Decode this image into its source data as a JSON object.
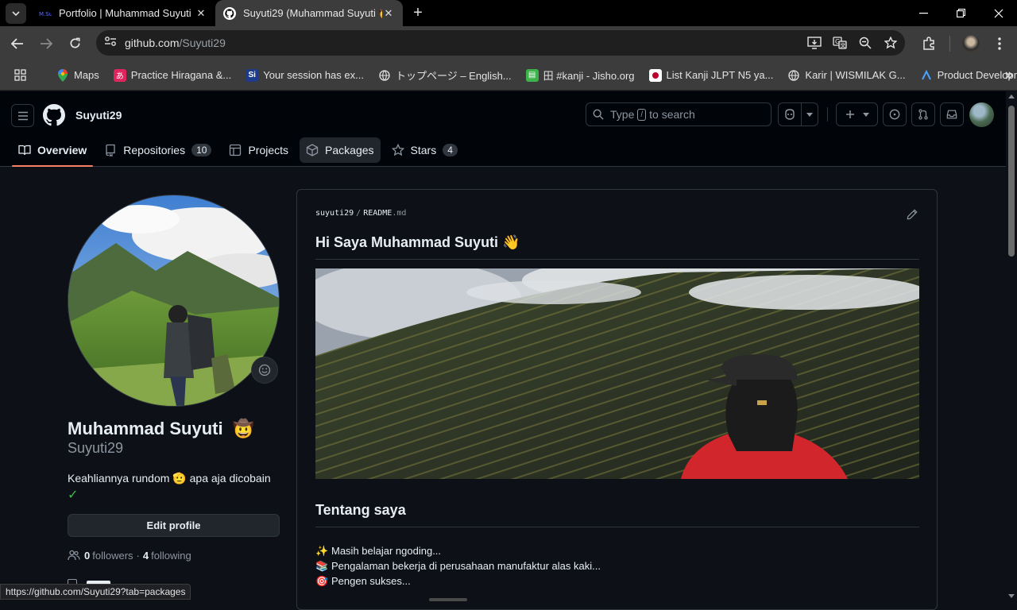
{
  "browser": {
    "tabs": [
      {
        "title": "Portfolio | Muhammad Suyuti",
        "favicon": "portfolio-favicon",
        "active": false
      },
      {
        "title": "Suyuti29 (Muhammad Suyuti 🤠",
        "favicon": "github-favicon",
        "active": true
      }
    ],
    "url_host": "github.com",
    "url_path": "/Suyuti29",
    "bookmarks": [
      {
        "label": "Maps",
        "icon": "maps-icon"
      },
      {
        "label": "Practice Hiragana &...",
        "icon": "hiragana-icon"
      },
      {
        "label": "Your session has ex...",
        "icon": "session-icon"
      },
      {
        "label": "トップページ – English...",
        "icon": "globe-icon"
      },
      {
        "label": "田 #kanji - Jisho.org",
        "icon": "jisho-icon"
      },
      {
        "label": "List Kanji JLPT N5 ya...",
        "icon": "japan-flag-icon"
      },
      {
        "label": "Karir | WISMILAK G...",
        "icon": "globe-icon"
      },
      {
        "label": "Product Developme...",
        "icon": "product-icon"
      }
    ],
    "status_url": "https://github.com/Suyuti29?tab=packages"
  },
  "header": {
    "username": "Suyuti29",
    "search_prefix": "Type",
    "search_key": "/",
    "search_suffix": "to search"
  },
  "nav": {
    "tabs": [
      {
        "label": "Overview",
        "icon": "book-icon",
        "count": null
      },
      {
        "label": "Repositories",
        "icon": "repo-icon",
        "count": "10"
      },
      {
        "label": "Projects",
        "icon": "table-icon",
        "count": null
      },
      {
        "label": "Packages",
        "icon": "package-icon",
        "count": null
      },
      {
        "label": "Stars",
        "icon": "star-icon",
        "count": "4"
      }
    ]
  },
  "profile": {
    "name": "Muhammad Suyuti",
    "name_emoji": "🤠",
    "login": "Suyuti29",
    "bio": "Keahliannya rundom 🫡 apa aja dicobain",
    "bio_check": "✓",
    "edit_label": "Edit profile",
    "followers": "0",
    "followers_label": "followers",
    "following": "4",
    "following_label": "following",
    "dot": "·"
  },
  "readme": {
    "owner": "suyuti29",
    "sep": "/",
    "file": "README",
    "ext": ".md",
    "heading": "Hi Saya Muhammad Suyuti 👋",
    "section_heading": "Tentang saya",
    "items": [
      {
        "emoji": "✨",
        "text": "Masih belajar ngoding..."
      },
      {
        "emoji": "📚",
        "text": "Pengalaman bekerja di perusahaan manufaktur alas kaki..."
      },
      {
        "emoji": "🎯",
        "text": "Pengen sukses..."
      }
    ]
  },
  "colors": {
    "background": "#0d1117",
    "header_bg": "#010409",
    "border": "#30363d",
    "accent_underline": "#f78166",
    "check": "#3fb950",
    "muted": "#8d96a0"
  }
}
